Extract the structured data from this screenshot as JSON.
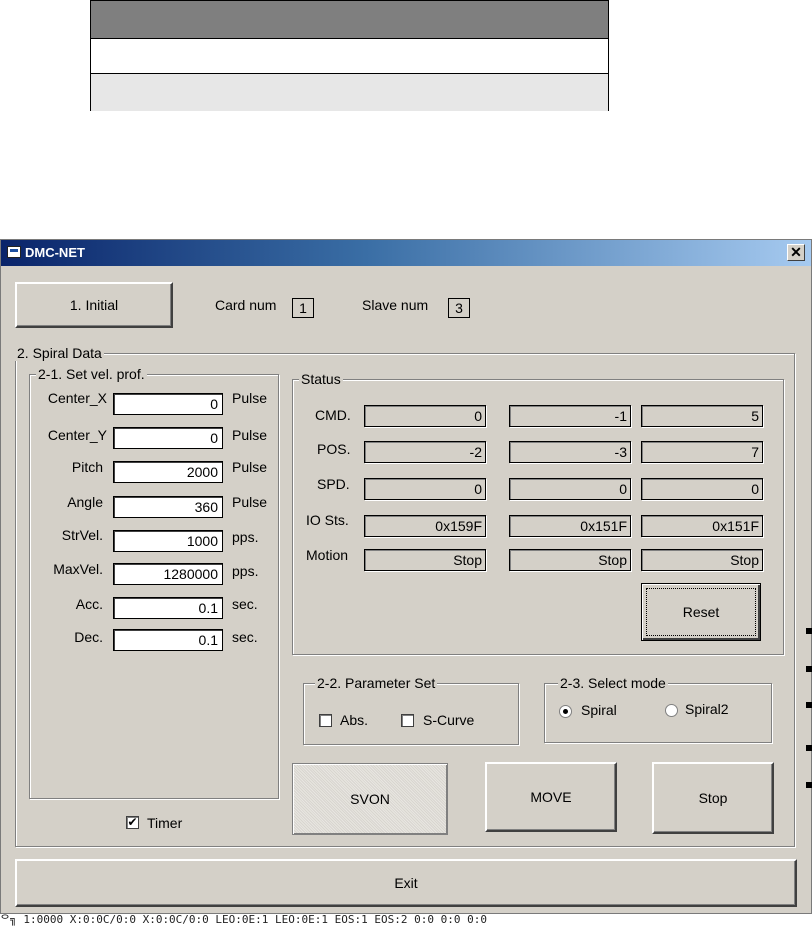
{
  "window": {
    "title": "DMC-NET",
    "close_glyph": "✕"
  },
  "top": {
    "initial_button": "1. Initial",
    "card_num_label": "Card num",
    "card_num_value": "1",
    "slave_num_label": "Slave num",
    "slave_num_value": "3"
  },
  "spiral": {
    "group_title": "2. Spiral Data",
    "velprof": {
      "title": "2-1. Set vel. prof.",
      "rows": [
        {
          "label": "Center_X",
          "value": "0",
          "unit": "Pulse"
        },
        {
          "label": "Center_Y",
          "value": "0",
          "unit": "Pulse"
        },
        {
          "label": "Pitch",
          "value": "2000",
          "unit": "Pulse"
        },
        {
          "label": "Angle",
          "value": "360",
          "unit": "Pulse"
        },
        {
          "label": "StrVel.",
          "value": "1000",
          "unit": "pps."
        },
        {
          "label": "MaxVel.",
          "value": "1280000",
          "unit": "pps."
        },
        {
          "label": "Acc.",
          "value": "0.1",
          "unit": "sec."
        },
        {
          "label": "Dec.",
          "value": "0.1",
          "unit": "sec."
        }
      ]
    },
    "timer_label": "Timer",
    "timer_checked": true
  },
  "status": {
    "title": "Status",
    "rows": [
      {
        "label": "CMD.",
        "values": [
          "0",
          "-1",
          "5"
        ]
      },
      {
        "label": "POS.",
        "values": [
          "-2",
          "-3",
          "7"
        ]
      },
      {
        "label": "SPD.",
        "values": [
          "0",
          "0",
          "0"
        ]
      },
      {
        "label": "IO Sts.",
        "values": [
          "0x159F",
          "0x151F",
          "0x151F"
        ]
      },
      {
        "label": "Motion",
        "values": [
          "Stop",
          "Stop",
          "Stop"
        ]
      }
    ],
    "reset_button": "Reset"
  },
  "param": {
    "title": "2-2. Parameter Set",
    "abs_label": "Abs.",
    "scurve_label": "S-Curve"
  },
  "mode": {
    "title": "2-3. Select mode",
    "spiral_label": "Spiral",
    "spiral2_label": "Spiral2",
    "selected": "Spiral"
  },
  "buttons": {
    "svon": "SVON",
    "move": "MOVE",
    "stop": "Stop",
    "exit": "Exit"
  },
  "check_glyph": "✔",
  "bottom_text": "ᄋ╗ 1:0000  X:0:0C/0:0  X:0:0C/0:0  LEO:0E:1  LEO:0E:1  EOS:1  EOS:2  0:0  0:0  0:0"
}
